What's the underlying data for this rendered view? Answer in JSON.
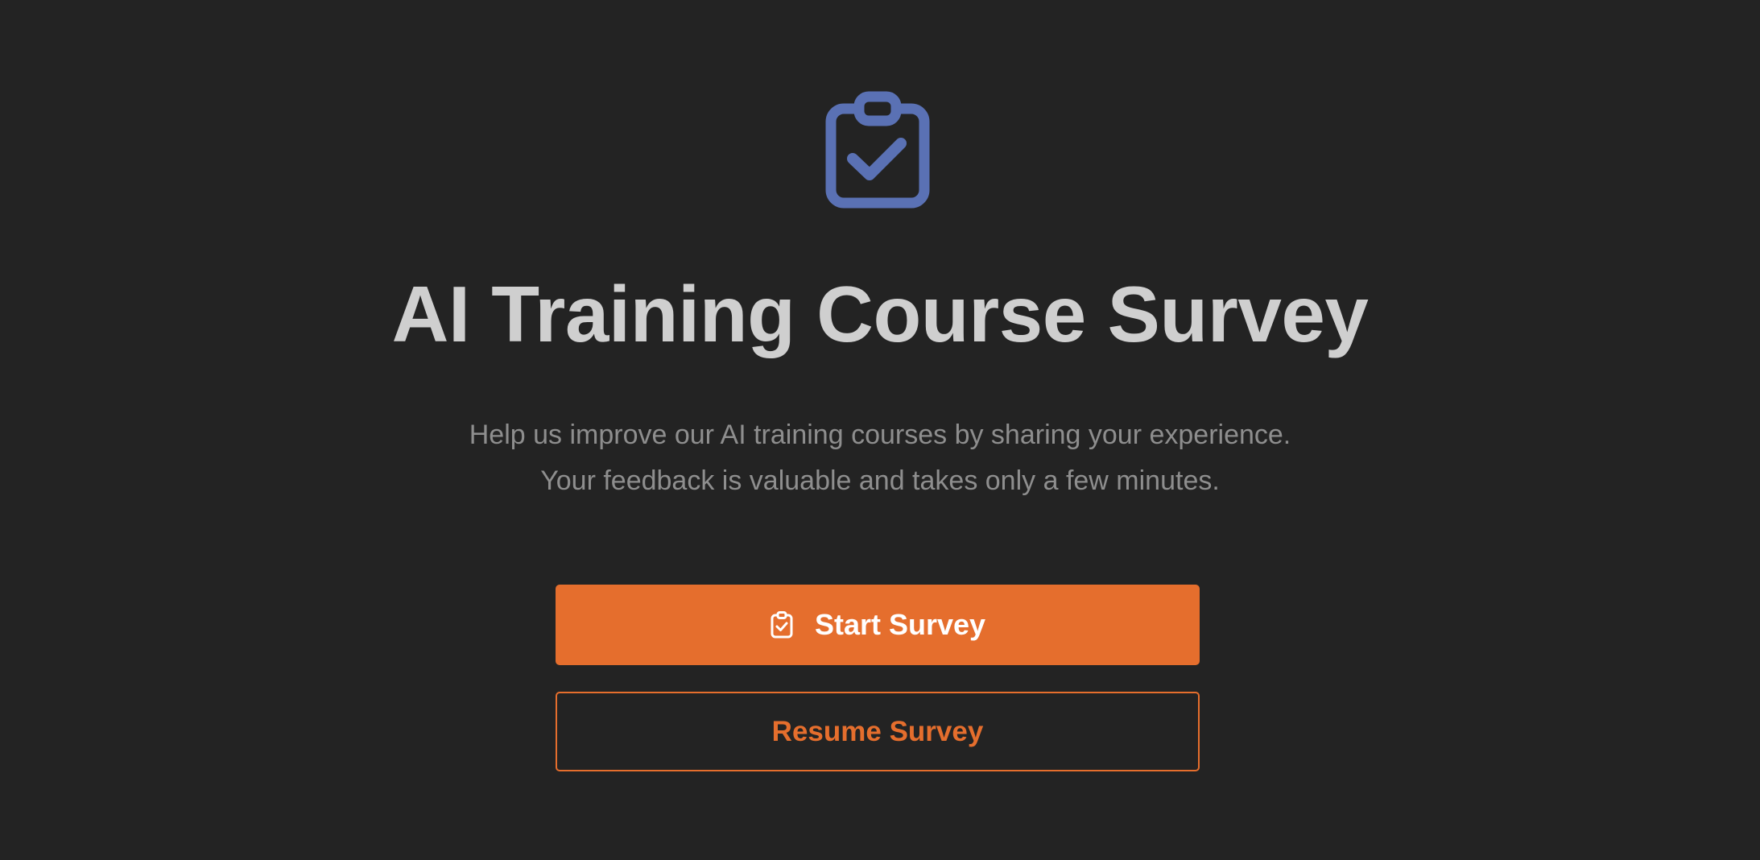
{
  "icons": {
    "hero": "clipboard-check-icon",
    "start_button": "clipboard-check-icon"
  },
  "colors": {
    "background": "#232323",
    "accent": "#e56e2d",
    "icon": "#5a71b4",
    "title": "#cfcfcf",
    "subtitle": "#8e8e8e"
  },
  "page": {
    "title": "AI Training Course Survey",
    "subtitle_line1": "Help us improve our AI training courses by sharing your experience.",
    "subtitle_line2": "Your feedback is valuable and takes only a few minutes."
  },
  "actions": {
    "start_label": "Start Survey",
    "resume_label": "Resume Survey"
  }
}
